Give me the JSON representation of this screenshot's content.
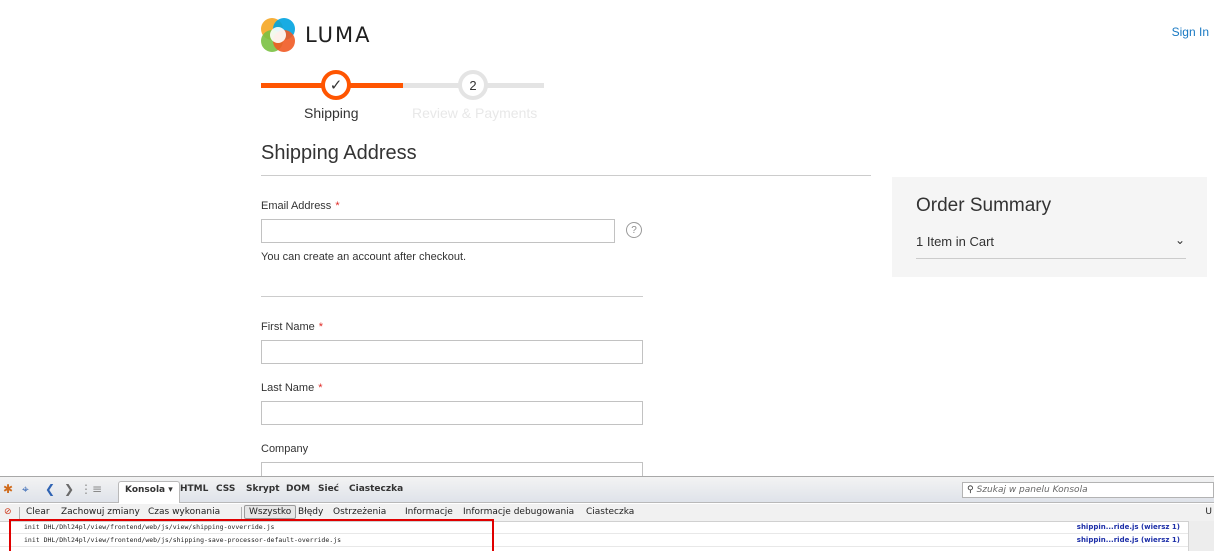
{
  "header": {
    "logo_text": "LUMA",
    "sign_in": "Sign In"
  },
  "progress": {
    "steps": [
      {
        "label": "Shipping",
        "state": "complete",
        "indicator": "✓"
      },
      {
        "label": "Review & Payments",
        "state": "pending",
        "indicator": "2"
      }
    ]
  },
  "shipping": {
    "title": "Shipping Address",
    "email_label": "Email Address",
    "required_mark": "*",
    "email_value": "",
    "help_icon": "?",
    "email_note": "You can create an account after checkout.",
    "first_name_label": "First Name",
    "first_name_value": "",
    "last_name_label": "Last Name",
    "last_name_value": "",
    "company_label": "Company",
    "company_value": ""
  },
  "summary": {
    "title": "Order Summary",
    "items": "1 Item in Cart"
  },
  "devtools": {
    "panels": [
      "Konsola ▾",
      "HTML",
      "CSS",
      "Skrypt",
      "DOM",
      "Sieć",
      "Ciasteczka"
    ],
    "search_placeholder": "Szukaj w panelu Konsola",
    "filters": [
      "Clear",
      "Zachowuj zmiany",
      "Czas wykonania",
      "Wszystko",
      "Błędy",
      "Ostrzeżenia",
      "Informacje",
      "Informacje debugowania",
      "Ciasteczka"
    ],
    "edge_char": "U",
    "logs": [
      {
        "text": "init DHL/Dhl24pl/view/frontend/web/js/view/shipping-ovverride.js",
        "source": "shippin...ride.js (wiersz 1)"
      },
      {
        "text": "init DHL/Dhl24pl/view/frontend/web/js/shipping-save-processor-default-override.js",
        "source": "shippin...ride.js (wiersz 1)"
      }
    ]
  },
  "colors": {
    "accent_orange": "#ff5501",
    "link_blue": "#1979c3",
    "required_red": "#e02b27",
    "highlight_red": "#e00000"
  },
  "icons": {
    "help": "question-circle-icon",
    "chevron": "chevron-down-icon",
    "check": "checkmark-icon"
  }
}
